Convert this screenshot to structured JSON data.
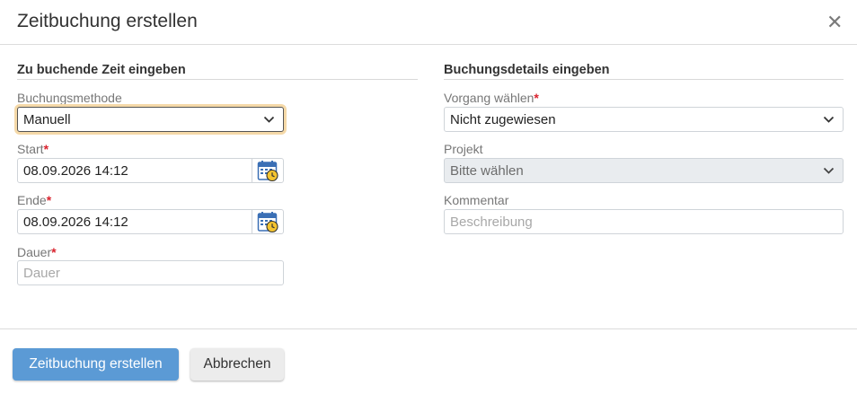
{
  "modal": {
    "title": "Zeitbuchung erstellen",
    "close_symbol": "✕"
  },
  "left": {
    "section_title": "Zu buchende Zeit eingeben",
    "method_label": "Buchungsmethode",
    "method_value": "Manuell",
    "start_label": "Start",
    "start_value": "08.09.2026 14:12",
    "end_label": "Ende",
    "end_value": "08.09.2026 14:12",
    "duration_label": "Dauer",
    "duration_placeholder": "Dauer",
    "required_mark": "*"
  },
  "right": {
    "section_title": "Buchungsdetails eingeben",
    "process_label": "Vorgang wählen",
    "process_value": "Nicht zugewiesen",
    "project_label": "Projekt",
    "project_value": "Bitte wählen",
    "comment_label": "Kommentar",
    "comment_placeholder": "Beschreibung"
  },
  "footer": {
    "submit_label": "Zeitbuchung erstellen",
    "cancel_label": "Abbrechen"
  },
  "colors": {
    "primary": "#5b9ad5",
    "required": "#d9232e",
    "focus_ring": "#f5d9a8"
  },
  "icons": [
    "close-icon",
    "chevron-down-icon",
    "calendar-clock-icon"
  ]
}
